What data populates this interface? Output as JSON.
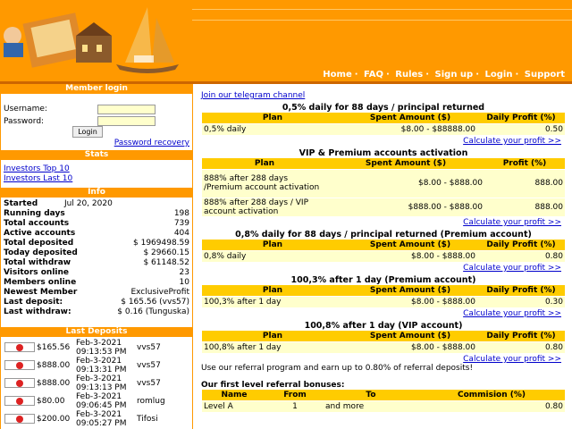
{
  "nav": [
    "Home",
    "FAQ",
    "Rules",
    "Sign up",
    "Login",
    "Support"
  ],
  "login": {
    "title": "Member login",
    "username_label": "Username:",
    "password_label": "Password:",
    "button": "Login",
    "recovery": "Password recovery"
  },
  "stats": {
    "title": "Stats",
    "links": [
      "Investors Top 10",
      "Investors Last 10"
    ]
  },
  "info": {
    "title": "Info",
    "rows": [
      {
        "k": "Started",
        "v": "Jul 20, 2020"
      },
      {
        "k": "Running days",
        "v": "198"
      },
      {
        "k": "Total accounts",
        "v": "739"
      },
      {
        "k": "Active accounts",
        "v": "404"
      },
      {
        "k": "Total deposited",
        "v": "$ 1969498.59"
      },
      {
        "k": "Today deposited",
        "v": "$ 29660.15"
      },
      {
        "k": "Total withdraw",
        "v": "$ 61148.52"
      },
      {
        "k": "Visitors online",
        "v": "23"
      },
      {
        "k": "Members online",
        "v": "10"
      },
      {
        "k": "Newest Member",
        "v": "ExclusiveProfit"
      },
      {
        "k": "Last deposit:",
        "v": "$ 165.56 (vvs57)"
      },
      {
        "k": "Last withdraw:",
        "v": "$ 0.16 (Tunguska)"
      }
    ]
  },
  "deposits": {
    "title": "Last Deposits",
    "rows": [
      {
        "amount": "$165.56",
        "date": "Feb-3-2021",
        "time": "09:13:53 PM",
        "user": "vvs57"
      },
      {
        "amount": "$888.00",
        "date": "Feb-3-2021",
        "time": "09:13:31 PM",
        "user": "vvs57"
      },
      {
        "amount": "$888.00",
        "date": "Feb-3-2021",
        "time": "09:13:13 PM",
        "user": "vvs57"
      },
      {
        "amount": "$80.00",
        "date": "Feb-3-2021",
        "time": "09:06:45 PM",
        "user": "romlug"
      },
      {
        "amount": "$200.00",
        "date": "Feb-3-2021",
        "time": "09:05:27 PM",
        "user": "Tifosi"
      }
    ]
  },
  "telegram": "Join our telegram channel",
  "calc_label": "Calculate your profit >>",
  "plans": [
    {
      "title": "0,5% daily for 88 days / principal returned",
      "headers": [
        "Plan",
        "Spent Amount ($)",
        "Daily Profit (%)"
      ],
      "rows": [
        [
          "0,5% daily",
          "$8.00 - $88888.00",
          "0.50"
        ]
      ]
    },
    {
      "title": "VIP & Premium accounts activation",
      "headers": [
        "Plan",
        "Spent Amount ($)",
        "Profit (%)"
      ],
      "rows": [
        [
          "888% after 288 days /Premium account activation",
          "$8.00 - $888.00",
          "888.00"
        ],
        [
          "888% after 288 days / VIP account activation",
          "$888.00 - $888.00",
          "888.00"
        ]
      ]
    },
    {
      "title": "0,8% daily for 88 days / principal returned (Premium account)",
      "headers": [
        "Plan",
        "Spent Amount ($)",
        "Daily Profit (%)"
      ],
      "rows": [
        [
          "0,8% daily",
          "$8.00 - $888.00",
          "0.80"
        ]
      ]
    },
    {
      "title": "100,3% after 1 day (Premium account)",
      "headers": [
        "Plan",
        "Spent Amount ($)",
        "Daily Profit (%)"
      ],
      "rows": [
        [
          "100,3% after 1 day",
          "$8.00 - $888.00",
          "0.30"
        ]
      ]
    },
    {
      "title": "100,8% after 1 day (VIP account)",
      "headers": [
        "Plan",
        "Spent Amount ($)",
        "Daily Profit (%)"
      ],
      "rows": [
        [
          "100,8% after 1 day",
          "$8.00 - $888.00",
          "0.80"
        ]
      ]
    }
  ],
  "referral": {
    "text": "Use our referral program and earn up to 0.80% of referral deposits!",
    "title": "Our first level referral bonuses:",
    "headers": [
      "Name",
      "From",
      "To",
      "Commision (%)"
    ],
    "rows": [
      [
        "Level A",
        "1",
        "and more",
        "0.80"
      ]
    ]
  },
  "colors": {
    "header": "#ff9900",
    "table_header": "#ffcc00",
    "table_row": "#ffffcc",
    "link": "#0000cc"
  }
}
